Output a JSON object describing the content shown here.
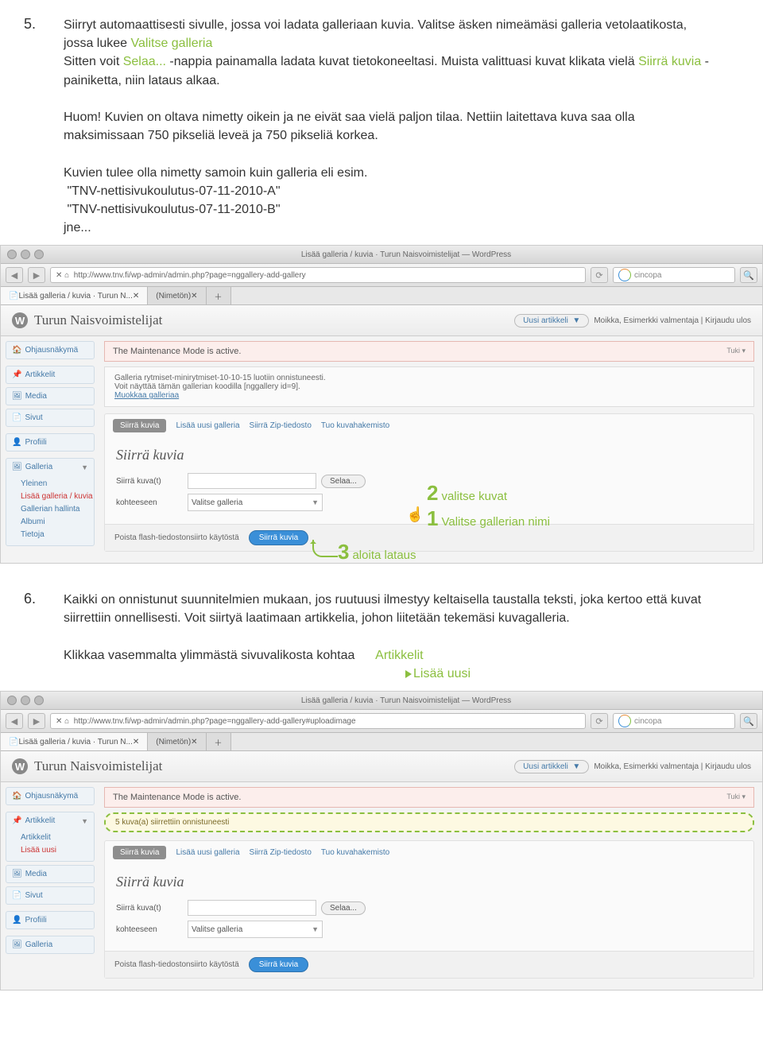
{
  "step5": {
    "num": "5.",
    "text1": "Siirryt automaattisesti sivulle, jossa voi ladata galleriaan kuvia. Valitse äsken nimeämäsi galleria vetolaatikosta, jossa lukee ",
    "hl1": "Valitse galleria",
    "text2": "Sitten voit ",
    "hl2": "Selaa...",
    "text3": " -nappia painamalla ladata kuvat tietokoneeltasi. Muista valittuasi kuvat klikata vielä ",
    "hl3": "Siirrä kuvia",
    "text4": " -painiketta, niin lataus alkaa.",
    "huom": "Huom! Kuvien on oltava nimetty oikein ja ne eivät saa vielä paljon tilaa. Nettiin laitettava kuva saa olla maksimissaan 750 pikseliä leveä ja 750 pikseliä korkea.",
    "naming1": "Kuvien tulee olla nimetty samoin kuin galleria eli esim.",
    "naming2": "\"TNV-nettisivukoulutus-07-11-2010-A\"",
    "naming3": "\"TNV-nettisivukoulutus-07-11-2010-B\"",
    "naming4": "jne..."
  },
  "browser": {
    "title": "Lisää galleria / kuvia · Turun Naisvoimistelijat — WordPress",
    "url1": "http://www.tnv.fi/wp-admin/admin.php?page=nggallery-add-gallery",
    "url2": "http://www.tnv.fi/wp-admin/admin.php?page=nggallery-add-gallery#uploadimage",
    "search": "cincopa",
    "tab1": "Lisää galleria / kuvia · Turun N...",
    "tab2": "(Nimetön)"
  },
  "wp": {
    "sitename": "Turun Naisvoimistelijat",
    "newpost": "Uusi artikkeli",
    "hello": "Moikka, Esimerkki valmentaja | Kirjaudu ulos",
    "maintenance": "The Maintenance Mode is active.",
    "tuki": "Tuki ▾",
    "okmsg1": "Galleria rytmiset-minirytmiset-10-10-15 luotiin onnistuneesti.",
    "okmsg2": "Voit näyttää tämän gallerian koodilla [nggallery id=9].",
    "okmsg3": "Muokkaa galleriaa",
    "yellow": "5 kuva(a) siirrettiin onnistuneesti"
  },
  "side": {
    "dash": "Ohjausnäkymä",
    "art": "Artikkelit",
    "art_all": "Artikkelit",
    "art_new": "Lisää uusi",
    "media": "Media",
    "pages": "Sivut",
    "profile": "Profiili",
    "gallery": "Galleria",
    "g1": "Yleinen",
    "g2": "Lisää galleria / kuvia",
    "g3": "Gallerian hallinta",
    "g4": "Albumi",
    "g5": "Tietoja"
  },
  "panel": {
    "tab_upload": "Siirrä kuvia",
    "tab_addgal": "Lisää uusi galleria",
    "tab_zip": "Siirrä Zip-tiedosto",
    "tab_import": "Tuo kuvahakemisto",
    "heading": "Siirrä kuvia",
    "row1": "Siirrä kuva(t)",
    "browse": "Selaa...",
    "row2": "kohteeseen",
    "select": "Valitse galleria",
    "foot_left": "Poista flash-tiedostonsiirto käytöstä",
    "foot_btn": "Siirrä kuvia"
  },
  "overlay": {
    "n1": "1",
    "t1": "Valitse gallerian nimi",
    "n2": "2",
    "t2": "valitse kuvat",
    "n3": "3",
    "t3": "aloita lataus"
  },
  "step6": {
    "num": "6.",
    "text1": "Kaikki on onnistunut suunnitelmien mukaan, jos ruutuusi ilmestyy keltaisella taustalla teksti, joka kertoo että kuvat siirrettiin onnellisesti. Voit siirtyä laatimaan artikkelia, johon liitetään tekemäsi kuvagalleria.",
    "text2": "Klikkaa vasemmalta ylimmästä sivuvalikosta  kohtaa",
    "link1": "Artikkelit",
    "link2": "Lisää uusi"
  }
}
